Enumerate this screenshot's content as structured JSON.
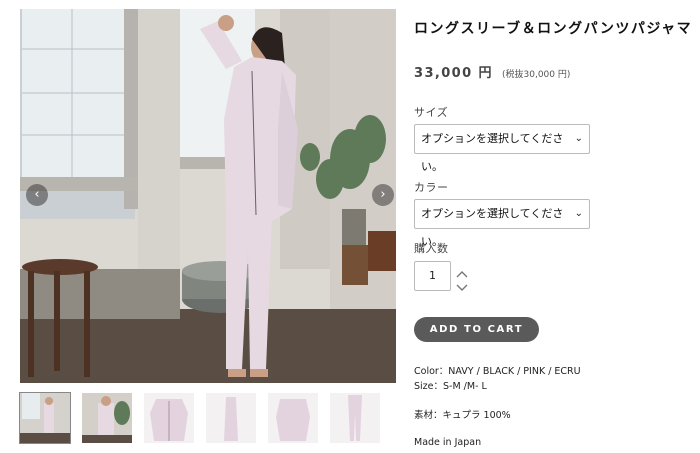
{
  "product": {
    "title": "ロングスリーブ＆ロングパンツパジャマ",
    "price": "33,000 円",
    "price_tax": "(税抜30,000 円)"
  },
  "options": {
    "size_label": "サイズ",
    "size_value": "オプションを選択してください。",
    "color_label": "カラー",
    "color_value": "オプションを選択してください。"
  },
  "quantity": {
    "label": "購入数",
    "value": "1"
  },
  "cart": {
    "button_label": "ADD TO CART"
  },
  "description": {
    "color_line": "Color：NAVY / BLACK / PINK / ECRU",
    "size_line": "Size：S-M /M- L",
    "material_line": "素材：キュプラ 100%",
    "origin_line": "Made in Japan"
  },
  "gallery": {
    "prev_icon": "chevron-left-icon",
    "next_icon": "chevron-right-icon",
    "thumbnail_count": 6,
    "active_index": 0
  },
  "colors": {
    "button_bg": "#5a5a5a",
    "pajama": "#e6d9e2"
  }
}
